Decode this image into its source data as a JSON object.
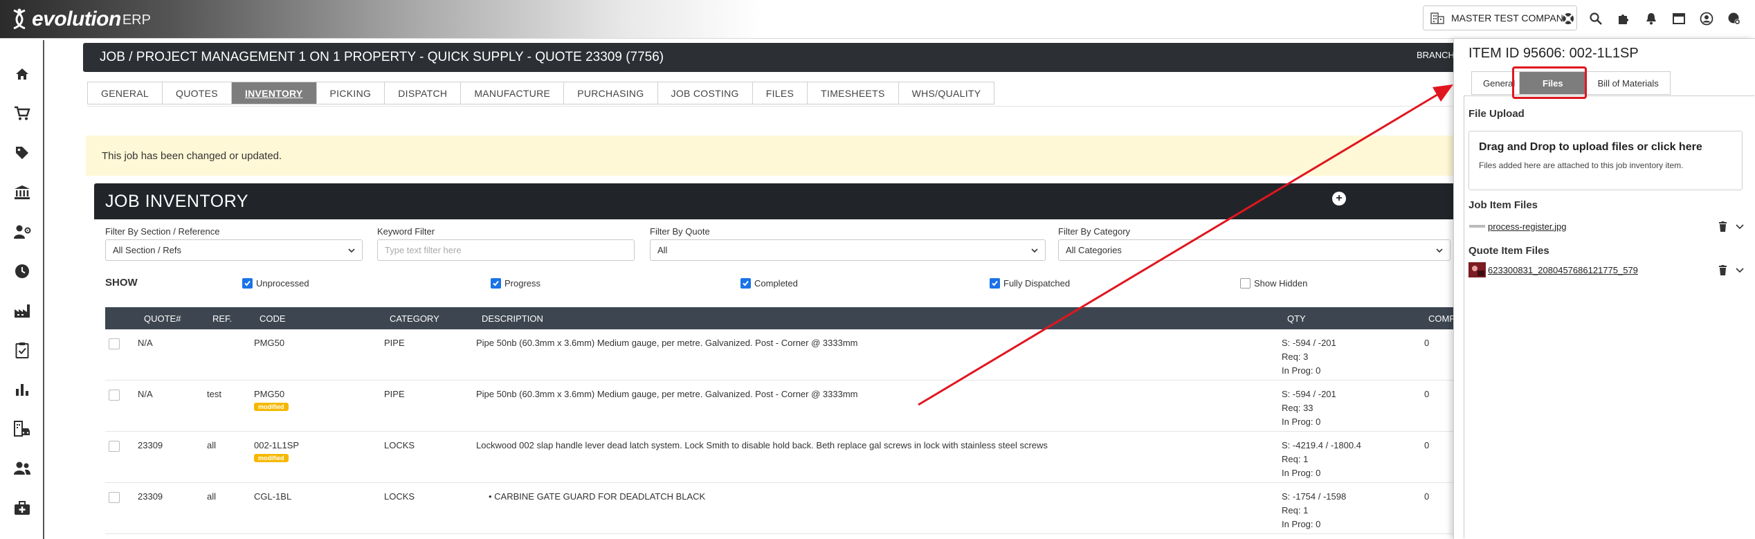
{
  "app": {
    "logo_text": "evolution",
    "logo_sub": "ERP"
  },
  "topbar": {
    "company": "MASTER TEST COMPANY"
  },
  "icons": {
    "top": [
      "building-icon",
      "lifebuoy-icon",
      "search-icon",
      "puzzle-icon",
      "bell-icon",
      "window-icon",
      "user-icon",
      "settings-user-icon"
    ],
    "sidebar": [
      "home-icon",
      "cart-icon",
      "tag-icon",
      "bank-icon",
      "user-cog-icon",
      "clock-icon",
      "factory-icon",
      "clipboard-check-icon",
      "bar-chart-icon",
      "building-car-icon",
      "users-icon",
      "medical-bag-icon"
    ]
  },
  "job": {
    "title": "JOB / PROJECT MANAGEMENT 1 ON 1 PROPERTY - QUICK SUPPLY - QUOTE 23309 (7756)",
    "branch": "BRANCH:"
  },
  "tabs": [
    {
      "label": "GENERAL"
    },
    {
      "label": "QUOTES"
    },
    {
      "label": "INVENTORY"
    },
    {
      "label": "PICKING"
    },
    {
      "label": "DISPATCH"
    },
    {
      "label": "MANUFACTURE"
    },
    {
      "label": "PURCHASING"
    },
    {
      "label": "JOB COSTING"
    },
    {
      "label": "FILES"
    },
    {
      "label": "TIMESHEETS"
    },
    {
      "label": "WHS/QUALITY"
    }
  ],
  "notice": "This job has been changed or updated.",
  "inventory": {
    "title": "JOB INVENTORY",
    "filters": {
      "section": {
        "label": "Filter By Section / Reference",
        "value": "All Section / Refs"
      },
      "keyword": {
        "label": "Keyword Filter",
        "placeholder": "Type text filter here"
      },
      "quote": {
        "label": "Filter By Quote",
        "value": "All"
      },
      "category": {
        "label": "Filter By Category",
        "value": "All Categories"
      }
    },
    "show": {
      "label": "SHOW",
      "options": [
        "Unprocessed",
        "Progress",
        "Completed",
        "Fully Dispatched",
        "Show Hidden"
      ]
    },
    "columns": [
      "QUOTE#",
      "REF.",
      "CODE",
      "CATEGORY",
      "DESCRIPTION",
      "QTY",
      "COMP"
    ],
    "rows": [
      {
        "quote": "N/A",
        "ref": "",
        "code": "PMG50",
        "badge": "",
        "category": "PIPE",
        "description": "Pipe 50nb (60.3mm x 3.6mm) Medium gauge, per metre. Galvanized. Post - Corner @ 3333mm",
        "qty_s": "S: -594 / -201",
        "qty_req": "Req: 3",
        "qty_prog": "In Prog: 0",
        "comp": "0"
      },
      {
        "quote": "N/A",
        "ref": "test",
        "code": "PMG50",
        "badge": "modified",
        "category": "PIPE",
        "description": "Pipe 50nb (60.3mm x 3.6mm) Medium gauge, per metre. Galvanized. Post - Corner @ 3333mm",
        "qty_s": "S: -594 / -201",
        "qty_req": "Req: 33",
        "qty_prog": "In Prog: 0",
        "comp": "0"
      },
      {
        "quote": "23309",
        "ref": "all",
        "code": "002-1L1SP",
        "badge": "modified",
        "category": "LOCKS",
        "description": "Lockwood 002 slap handle lever dead latch system. Lock Smith to disable hold back. Beth replace gal screws in lock with stainless steel screws",
        "qty_s": "S: -4219.4 / -1800.4",
        "qty_req": "Req: 1",
        "qty_prog": "In Prog: 0",
        "comp": "0"
      },
      {
        "quote": "23309",
        "ref": "all",
        "code": "CGL-1BL",
        "badge": "",
        "category": "LOCKS",
        "description": "• CARBINE GATE GUARD FOR DEADLATCH BLACK",
        "qty_s": "S: -1754 / -1598",
        "qty_req": "Req: 1",
        "qty_prog": "In Prog: 0",
        "comp": "0"
      }
    ]
  },
  "panel": {
    "title": "ITEM ID 95606: 002-1L1SP",
    "tabs": [
      {
        "label": "General"
      },
      {
        "label": "Files"
      },
      {
        "label": "Bill of Materials"
      }
    ],
    "upload_title": "File Upload",
    "upload_heading": "Drag and Drop to upload files or click here",
    "upload_sub": "Files added here are attached to this job inventory item.",
    "job_files_title": "Job Item Files",
    "job_files": [
      {
        "name": "process-register.jpg"
      }
    ],
    "quote_files_title": "Quote Item Files",
    "quote_files": [
      {
        "name": "623300831_2080457686121775_579"
      }
    ]
  },
  "colors": {
    "accent_red": "#e0161f",
    "active_tab": "#7d7d7d",
    "checkbox": "#1a73e8",
    "badge": "#f5b800",
    "notice_bg": "#fff8d6"
  }
}
